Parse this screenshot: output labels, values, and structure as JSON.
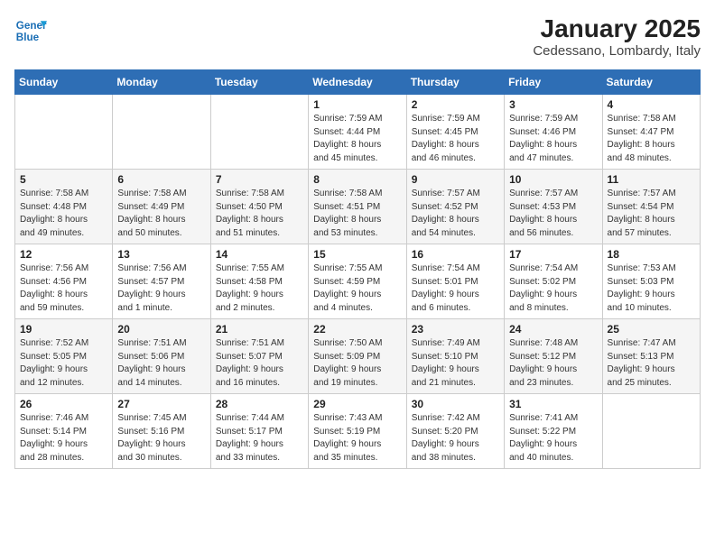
{
  "logo": {
    "line1": "General",
    "line2": "Blue"
  },
  "title": "January 2025",
  "subtitle": "Cedessano, Lombardy, Italy",
  "days_of_week": [
    "Sunday",
    "Monday",
    "Tuesday",
    "Wednesday",
    "Thursday",
    "Friday",
    "Saturday"
  ],
  "weeks": [
    [
      {
        "day": "",
        "info": ""
      },
      {
        "day": "",
        "info": ""
      },
      {
        "day": "",
        "info": ""
      },
      {
        "day": "1",
        "info": "Sunrise: 7:59 AM\nSunset: 4:44 PM\nDaylight: 8 hours\nand 45 minutes."
      },
      {
        "day": "2",
        "info": "Sunrise: 7:59 AM\nSunset: 4:45 PM\nDaylight: 8 hours\nand 46 minutes."
      },
      {
        "day": "3",
        "info": "Sunrise: 7:59 AM\nSunset: 4:46 PM\nDaylight: 8 hours\nand 47 minutes."
      },
      {
        "day": "4",
        "info": "Sunrise: 7:58 AM\nSunset: 4:47 PM\nDaylight: 8 hours\nand 48 minutes."
      }
    ],
    [
      {
        "day": "5",
        "info": "Sunrise: 7:58 AM\nSunset: 4:48 PM\nDaylight: 8 hours\nand 49 minutes."
      },
      {
        "day": "6",
        "info": "Sunrise: 7:58 AM\nSunset: 4:49 PM\nDaylight: 8 hours\nand 50 minutes."
      },
      {
        "day": "7",
        "info": "Sunrise: 7:58 AM\nSunset: 4:50 PM\nDaylight: 8 hours\nand 51 minutes."
      },
      {
        "day": "8",
        "info": "Sunrise: 7:58 AM\nSunset: 4:51 PM\nDaylight: 8 hours\nand 53 minutes."
      },
      {
        "day": "9",
        "info": "Sunrise: 7:57 AM\nSunset: 4:52 PM\nDaylight: 8 hours\nand 54 minutes."
      },
      {
        "day": "10",
        "info": "Sunrise: 7:57 AM\nSunset: 4:53 PM\nDaylight: 8 hours\nand 56 minutes."
      },
      {
        "day": "11",
        "info": "Sunrise: 7:57 AM\nSunset: 4:54 PM\nDaylight: 8 hours\nand 57 minutes."
      }
    ],
    [
      {
        "day": "12",
        "info": "Sunrise: 7:56 AM\nSunset: 4:56 PM\nDaylight: 8 hours\nand 59 minutes."
      },
      {
        "day": "13",
        "info": "Sunrise: 7:56 AM\nSunset: 4:57 PM\nDaylight: 9 hours\nand 1 minute."
      },
      {
        "day": "14",
        "info": "Sunrise: 7:55 AM\nSunset: 4:58 PM\nDaylight: 9 hours\nand 2 minutes."
      },
      {
        "day": "15",
        "info": "Sunrise: 7:55 AM\nSunset: 4:59 PM\nDaylight: 9 hours\nand 4 minutes."
      },
      {
        "day": "16",
        "info": "Sunrise: 7:54 AM\nSunset: 5:01 PM\nDaylight: 9 hours\nand 6 minutes."
      },
      {
        "day": "17",
        "info": "Sunrise: 7:54 AM\nSunset: 5:02 PM\nDaylight: 9 hours\nand 8 minutes."
      },
      {
        "day": "18",
        "info": "Sunrise: 7:53 AM\nSunset: 5:03 PM\nDaylight: 9 hours\nand 10 minutes."
      }
    ],
    [
      {
        "day": "19",
        "info": "Sunrise: 7:52 AM\nSunset: 5:05 PM\nDaylight: 9 hours\nand 12 minutes."
      },
      {
        "day": "20",
        "info": "Sunrise: 7:51 AM\nSunset: 5:06 PM\nDaylight: 9 hours\nand 14 minutes."
      },
      {
        "day": "21",
        "info": "Sunrise: 7:51 AM\nSunset: 5:07 PM\nDaylight: 9 hours\nand 16 minutes."
      },
      {
        "day": "22",
        "info": "Sunrise: 7:50 AM\nSunset: 5:09 PM\nDaylight: 9 hours\nand 19 minutes."
      },
      {
        "day": "23",
        "info": "Sunrise: 7:49 AM\nSunset: 5:10 PM\nDaylight: 9 hours\nand 21 minutes."
      },
      {
        "day": "24",
        "info": "Sunrise: 7:48 AM\nSunset: 5:12 PM\nDaylight: 9 hours\nand 23 minutes."
      },
      {
        "day": "25",
        "info": "Sunrise: 7:47 AM\nSunset: 5:13 PM\nDaylight: 9 hours\nand 25 minutes."
      }
    ],
    [
      {
        "day": "26",
        "info": "Sunrise: 7:46 AM\nSunset: 5:14 PM\nDaylight: 9 hours\nand 28 minutes."
      },
      {
        "day": "27",
        "info": "Sunrise: 7:45 AM\nSunset: 5:16 PM\nDaylight: 9 hours\nand 30 minutes."
      },
      {
        "day": "28",
        "info": "Sunrise: 7:44 AM\nSunset: 5:17 PM\nDaylight: 9 hours\nand 33 minutes."
      },
      {
        "day": "29",
        "info": "Sunrise: 7:43 AM\nSunset: 5:19 PM\nDaylight: 9 hours\nand 35 minutes."
      },
      {
        "day": "30",
        "info": "Sunrise: 7:42 AM\nSunset: 5:20 PM\nDaylight: 9 hours\nand 38 minutes."
      },
      {
        "day": "31",
        "info": "Sunrise: 7:41 AM\nSunset: 5:22 PM\nDaylight: 9 hours\nand 40 minutes."
      },
      {
        "day": "",
        "info": ""
      }
    ]
  ]
}
